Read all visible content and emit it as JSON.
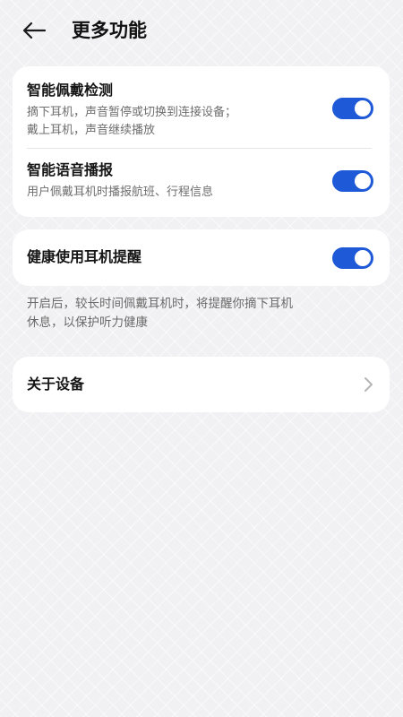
{
  "header": {
    "title": "更多功能",
    "back_icon": "arrow-left-icon"
  },
  "colors": {
    "accent": "#1e5ad7",
    "background": "#f1f1f3",
    "card": "#ffffff"
  },
  "settings_group_1": {
    "items": [
      {
        "title": "智能佩戴检测",
        "description_line1": "摘下耳机，声音暂停或切换到连接设备；",
        "description_line2": "戴上耳机，声音继续播放",
        "enabled": true
      },
      {
        "title": "智能语音播报",
        "description_line1": "用户佩戴耳机时播报航班、行程信息",
        "enabled": true
      }
    ]
  },
  "settings_group_2": {
    "title": "健康使用耳机提醒",
    "enabled": true,
    "note_line1": "开启后，较长时间佩戴耳机时，将提醒你摘下耳机",
    "note_line2": "休息，以保护听力健康"
  },
  "about": {
    "label": "关于设备",
    "icon": "chevron-right-icon"
  }
}
